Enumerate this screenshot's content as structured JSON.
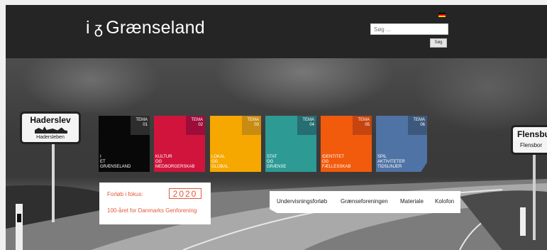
{
  "site": {
    "logo_prefix": "i",
    "logo_mark": "ᵹ",
    "logo_text": "Grænseland"
  },
  "language_flag": {
    "icon": "german-flag-icon",
    "colors": [
      "#000000",
      "#dd0000",
      "#ffce00"
    ]
  },
  "search": {
    "placeholder": "Søg ...",
    "button_label": "Søg"
  },
  "hero_signs": {
    "left_name": "Haderslev",
    "left_sub": "Hadersleben",
    "right_name": "Flensbur",
    "right_sub": "Flensbor"
  },
  "themes": [
    {
      "tag": "TEMA\n01",
      "label": "I\nET\nGRÆNSELAND",
      "color": "#080808"
    },
    {
      "tag": "TEMA\n02",
      "label": "KULTUR\nOG\nMEDBORGERSKAB",
      "color": "#d1143c"
    },
    {
      "tag": "TEMA\n03",
      "label": "LOKAL\nOG\nGLOBAL",
      "color": "#f6a700"
    },
    {
      "tag": "TEMA\n04",
      "label": "STAT\nOG\nGRÆNSE",
      "color": "#2d9a94"
    },
    {
      "tag": "TEMA\n05",
      "label": "IDENTITET\nOG\nFÆLLESSKAB",
      "color": "#f25a0c"
    },
    {
      "tag": "TEMA\n06",
      "label": "SPIL\nAKTIVITETER\nTIDSLINJER",
      "color": "#4f73a5"
    }
  ],
  "focus": {
    "heading": "Forløb i fokus:",
    "year": "2020",
    "subtitle": "100-året for Danmarks Genforening",
    "accent": "#e05a3a"
  },
  "menu": {
    "items": [
      "Undervisningsforløb",
      "Grænseforeningen",
      "Materiale",
      "Kolofon"
    ]
  }
}
